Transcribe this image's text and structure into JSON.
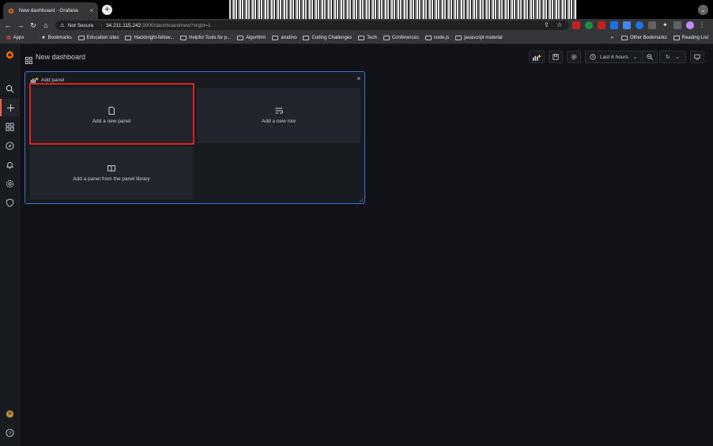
{
  "browser": {
    "tab_title": "New dashboard - Grafana",
    "tab_close": "×",
    "new_tab": "+",
    "address_warning": "Not Secure",
    "address_host": "34.211.115.242",
    "address_path": ":3000/dashboard/new?orgId=1",
    "bookmarks": [
      "Apps",
      "Bookmarks",
      "Education sites",
      "Hackbright-fellow...",
      "Helpful Tools for p...",
      "Algorithm",
      "arudino",
      "Coding Challenges",
      "Tech",
      "Conferences",
      "node.js",
      "javascript material"
    ],
    "bookmarks_overflow": "»",
    "other_bookmarks": "Other Bookmarks",
    "reading_list": "Reading List"
  },
  "header": {
    "title": "New dashboard",
    "time_range": "Last 6 hours"
  },
  "panel": {
    "title": "Add panel",
    "close": "×",
    "options": [
      {
        "label": "Add a new panel",
        "icon": "file-icon"
      },
      {
        "label": "Add a new row",
        "icon": "row-icon"
      },
      {
        "label": "Add a panel from the panel library",
        "icon": "book-icon"
      }
    ]
  },
  "colors": {
    "accent_orange": "#f55f3e",
    "focus_blue": "#3d71d9",
    "annotation_red": "#e02020",
    "background": "#111217"
  }
}
